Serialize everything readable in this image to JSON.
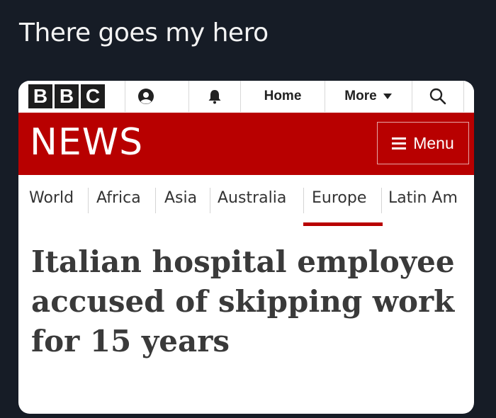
{
  "caption": "There goes my hero",
  "header": {
    "logo_letters": [
      "B",
      "B",
      "C"
    ],
    "icons": [
      "account-icon",
      "notification-bell-icon",
      "search-icon"
    ],
    "home_label": "Home",
    "more_label": "More",
    "more_icon": "caret-down-icon"
  },
  "news_bar": {
    "title": "NEWS",
    "menu_label": "Menu",
    "menu_icon": "hamburger-icon",
    "background_color": "#b80000"
  },
  "sections": {
    "items": [
      {
        "label": "World"
      },
      {
        "label": "Africa"
      },
      {
        "label": "Asia"
      },
      {
        "label": "Australia"
      },
      {
        "label": "Europe",
        "selected": true
      },
      {
        "label": "Latin Am"
      }
    ],
    "accent_color": "#b80000"
  },
  "article": {
    "headline": "Italian hospital employee accused of skipping work for 15 years"
  }
}
